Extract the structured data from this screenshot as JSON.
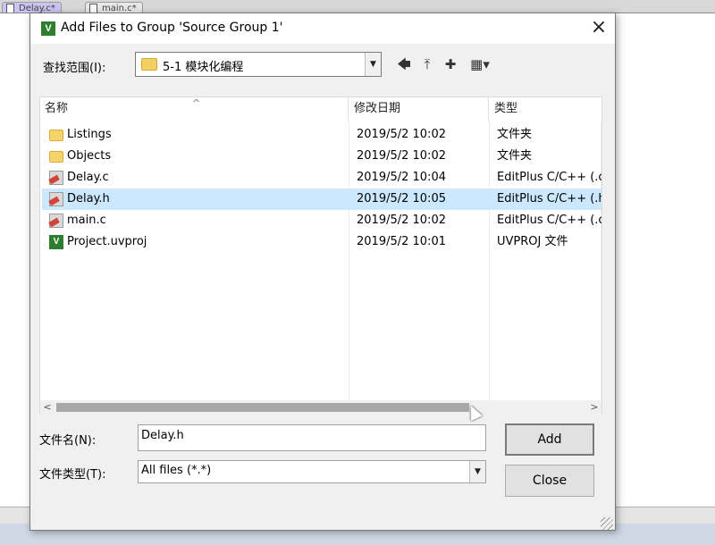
{
  "background": {
    "tabs": [
      {
        "label": "Delay.c*"
      },
      {
        "label": "main.c*"
      }
    ]
  },
  "dialog": {
    "title": "Add Files to Group 'Source Group 1'",
    "close_glyph": "×",
    "look_in_label": "查找范围(I):",
    "look_in_value": "5-1 模块化编程",
    "toolbar": {
      "back_glyph": "🡄",
      "up_glyph": "⤒",
      "new_folder_glyph": "✚",
      "view_glyph": "▦▾"
    },
    "columns": [
      {
        "label": "名称"
      },
      {
        "label": "修改日期"
      },
      {
        "label": "类型"
      }
    ],
    "sort_glyph": "^",
    "files": [
      {
        "name": "Listings",
        "date": "2019/5/2 10:02",
        "type": "文件夹",
        "icon": "folder-icon",
        "selected": false
      },
      {
        "name": "Objects",
        "date": "2019/5/2 10:02",
        "type": "文件夹",
        "icon": "folder-icon",
        "selected": false
      },
      {
        "name": "Delay.c",
        "date": "2019/5/2 10:04",
        "type": "EditPlus C/C++ (.c",
        "icon": "editplus-file-icon",
        "selected": false
      },
      {
        "name": "Delay.h",
        "date": "2019/5/2 10:05",
        "type": "EditPlus C/C++ (.h",
        "icon": "editplus-file-icon",
        "selected": true
      },
      {
        "name": "main.c",
        "date": "2019/5/2 10:02",
        "type": "EditPlus C/C++ (.c",
        "icon": "editplus-file-icon",
        "selected": false
      },
      {
        "name": "Project.uvproj",
        "date": "2019/5/2 10:01",
        "type": "UVPROJ 文件",
        "icon": "uvproj-file-icon",
        "selected": false
      }
    ],
    "scroll": {
      "left_glyph": "<",
      "right_glyph": ">",
      "thumb_fraction": 0.78
    },
    "filename_label": "文件名(N):",
    "filename_value": "Delay.h",
    "filetype_label": "文件类型(T):",
    "filetype_value": "All files (*.*)",
    "add_label": "Add",
    "close_label": "Close"
  }
}
